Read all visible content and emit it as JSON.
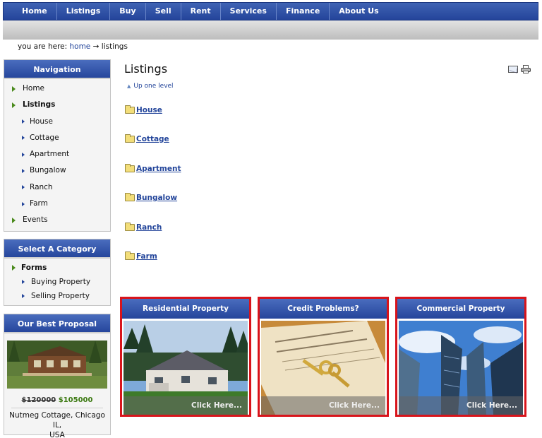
{
  "topnav": [
    "Home",
    "Listings",
    "Buy",
    "Sell",
    "Rent",
    "Services",
    "Finance",
    "About Us"
  ],
  "breadcrumb": {
    "prefix": "you are here:",
    "home": "home",
    "arrow": "→",
    "current": "listings"
  },
  "navigation": {
    "title": "Navigation",
    "items": [
      {
        "label": "Home",
        "level": "top"
      },
      {
        "label": "Listings",
        "level": "top",
        "bold": true
      },
      {
        "label": "House",
        "level": "sub"
      },
      {
        "label": "Cottage",
        "level": "sub"
      },
      {
        "label": "Apartment",
        "level": "sub"
      },
      {
        "label": "Bungalow",
        "level": "sub"
      },
      {
        "label": "Ranch",
        "level": "sub"
      },
      {
        "label": "Farm",
        "level": "sub"
      },
      {
        "label": "Events",
        "level": "top"
      }
    ]
  },
  "category": {
    "title": "Select A Category",
    "items": [
      {
        "label": "Forms",
        "level": "top",
        "bold": true
      },
      {
        "label": "Buying Property",
        "level": "sub"
      },
      {
        "label": "Selling Property",
        "level": "sub"
      }
    ]
  },
  "proposal": {
    "title": "Our Best Proposal",
    "old_price": "$120000",
    "new_price": "$105000",
    "caption_line1": "Nutmeg Cottage, Chicago IL,",
    "caption_line2": "USA"
  },
  "main": {
    "title": "Listings",
    "up_one_level": "Up one level",
    "folders": [
      "House",
      "Cottage",
      "Apartment",
      "Bungalow",
      "Ranch",
      "Farm"
    ]
  },
  "cards": [
    {
      "title": "Residential Property",
      "cta": "Click Here..."
    },
    {
      "title": "Credit Problems?",
      "cta": "Click Here..."
    },
    {
      "title": "Commercial Property",
      "cta": "Click Here..."
    }
  ],
  "icons": {
    "email": "email-icon",
    "print": "print-icon"
  },
  "colors": {
    "nav_blue": "#2a4a9e",
    "card_border": "#d8141b",
    "link": "#22449a",
    "price_new": "#3d7a13"
  }
}
